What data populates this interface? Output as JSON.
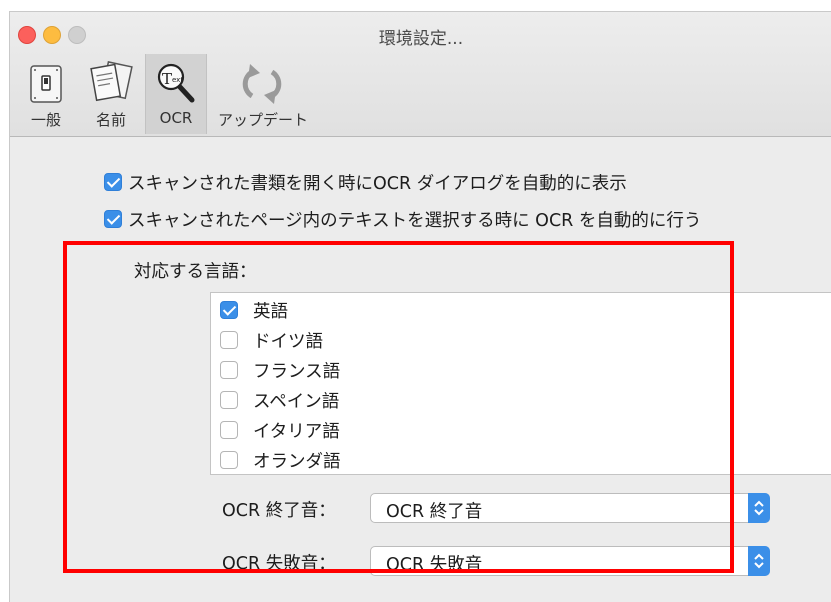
{
  "window": {
    "title": "環境設定..."
  },
  "toolbar": {
    "items": [
      {
        "label": "一般",
        "icon": "switch-icon"
      },
      {
        "label": "名前",
        "icon": "documents-icon"
      },
      {
        "label": "OCR",
        "icon": "ocr-magnifier-icon",
        "active": true
      },
      {
        "label": "アップデート",
        "icon": "refresh-icon"
      }
    ]
  },
  "options": {
    "open_dialog": {
      "label": "スキャンされた書類を開く時にOCR ダイアログを自動的に表示",
      "checked": true
    },
    "auto_ocr": {
      "label": "スキャンされたページ内のテキストを選択する時に OCR を自動的に行う",
      "checked": true
    }
  },
  "languages": {
    "title": "対応する言語：",
    "items": [
      {
        "label": "英語",
        "checked": true
      },
      {
        "label": "ドイツ語",
        "checked": false
      },
      {
        "label": "フランス語",
        "checked": false
      },
      {
        "label": "スペイン語",
        "checked": false
      },
      {
        "label": "イタリア語",
        "checked": false
      },
      {
        "label": "オランダ語",
        "checked": false
      }
    ]
  },
  "sounds": {
    "finish": {
      "label": "OCR 終了音：",
      "value": "OCR 終了音"
    },
    "fail": {
      "label": "OCR 失敗音：",
      "value": "OCR 失敗音"
    }
  },
  "colors": {
    "accent": "#3b8fe8",
    "highlight": "#ff0000"
  }
}
